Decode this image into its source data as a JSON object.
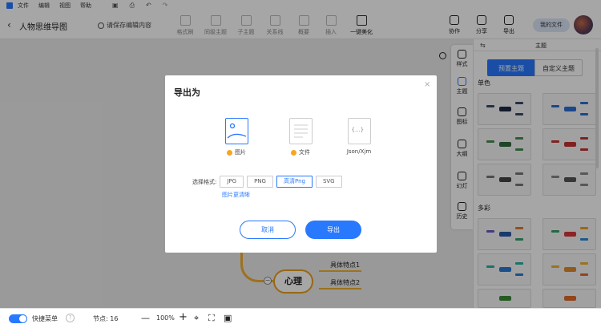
{
  "menubar": {
    "items": [
      "文件",
      "编辑",
      "视图",
      "帮助"
    ]
  },
  "toolbar": {
    "title": "人物思维导图",
    "save_hint": "请保存编辑内容",
    "tools": [
      "格式刷",
      "同级主题",
      "子主题",
      "关系线",
      "概要",
      "插入",
      "一键美化"
    ],
    "right_tools": [
      "协作",
      "分享",
      "导出"
    ],
    "my_files": "我的文件"
  },
  "canvas": {
    "node": "心理",
    "sub1": "具体特点1",
    "sub2": "具体特点2",
    "collapse": "−"
  },
  "side_tabs": [
    "样式",
    "主题",
    "图标",
    "大纲",
    "幻灯",
    "历史"
  ],
  "panel": {
    "title": "主题",
    "expand": "⇆",
    "tab_preset": "预置主题",
    "tab_custom": "自定义主题",
    "section_single": "单色",
    "section_multi": "多彩"
  },
  "dialog": {
    "title": "导出为",
    "close": "×",
    "formats": [
      {
        "label": "图片",
        "premium": true
      },
      {
        "label": "文件",
        "premium": true
      },
      {
        "label": "Json/Xjm",
        "premium": false
      }
    ],
    "json_glyph": "{...}",
    "select_label": "选择格式:",
    "options": [
      "JPG",
      "PNG",
      "高清Png",
      "SVG"
    ],
    "selected_option": "高清Png",
    "unclear_link": "图片更清晰",
    "cancel": "取消",
    "export": "导出"
  },
  "statusbar": {
    "quick_menu": "快捷菜单",
    "help": "?",
    "nodes": "节点: 16",
    "zoom": "100%",
    "minus": "—",
    "plus": "+"
  }
}
